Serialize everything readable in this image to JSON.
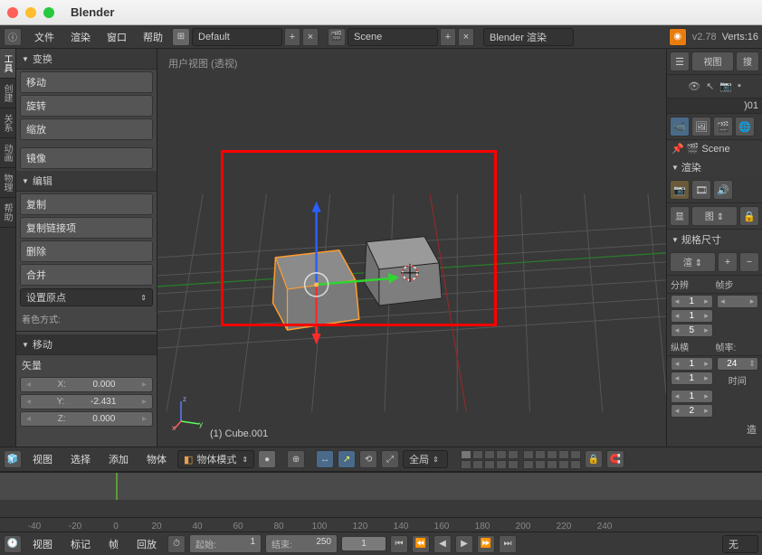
{
  "app_title": "Blender",
  "topmenu": {
    "file": "文件",
    "render": "渲染",
    "window": "窗口",
    "help": "帮助",
    "layout": "Default",
    "scene": "Scene",
    "engine": "Blender 渲染",
    "version": "v2.78",
    "stats": "Verts:16"
  },
  "lefttabs": [
    "工具",
    "创建",
    "关系",
    "动画",
    "物理",
    "帮助"
  ],
  "toolpanel": {
    "transform_hdr": "变换",
    "move": "移动",
    "rotate": "旋转",
    "scale": "缩放",
    "mirror": "镜像",
    "edit_hdr": "编辑",
    "dup": "复制",
    "duplink": "复制链接项",
    "del": "删除",
    "join": "合并",
    "setorig": "设置原点",
    "shade": "着色方式:",
    "move_panel": "移动",
    "vector_lbl": "矢量",
    "x": "X:",
    "y": "Y:",
    "z": "Z:",
    "xv": "0.000",
    "yv": "-2.431",
    "zv": "0.000"
  },
  "viewport": {
    "label": "用户视图 (透视)",
    "objname": "(1) Cube.001"
  },
  "vpmenu": {
    "view": "视图",
    "select": "选择",
    "add": "添加",
    "object": "物体",
    "mode": "物体模式",
    "global": "全局"
  },
  "right": {
    "view": "视图",
    "search_ph": "搜",
    "scene_lbl": "Scene",
    "render_hdr": "渲染",
    "display": "显",
    "tu": "图",
    "dims_hdr": "规格尺寸",
    "render_preset": "渲",
    "res_lbl": "分辨",
    "fps_lbl": "帧步",
    "res1": "1",
    "res2": "1",
    "res3": "5",
    "ar_lbl": "纵横",
    "rate_lbl": "帧率:",
    "ar1": "1",
    "ar2": "1",
    "fps": "24",
    "time_lbl": "时间",
    "t1": "1",
    "t2": "2",
    "makeup": "造"
  },
  "timeline": {
    "ticks": [
      "-40",
      "-20",
      "0",
      "20",
      "40",
      "60",
      "80",
      "100",
      "120",
      "140",
      "160",
      "180",
      "200",
      "220",
      "240"
    ],
    "view": "视图",
    "marker": "标记",
    "frame": "帧",
    "playback": "回放",
    "start_lbl": "起始:",
    "start_v": "1",
    "end_lbl": "结束:",
    "end_v": "250",
    "cur": "1",
    "none": "无"
  }
}
